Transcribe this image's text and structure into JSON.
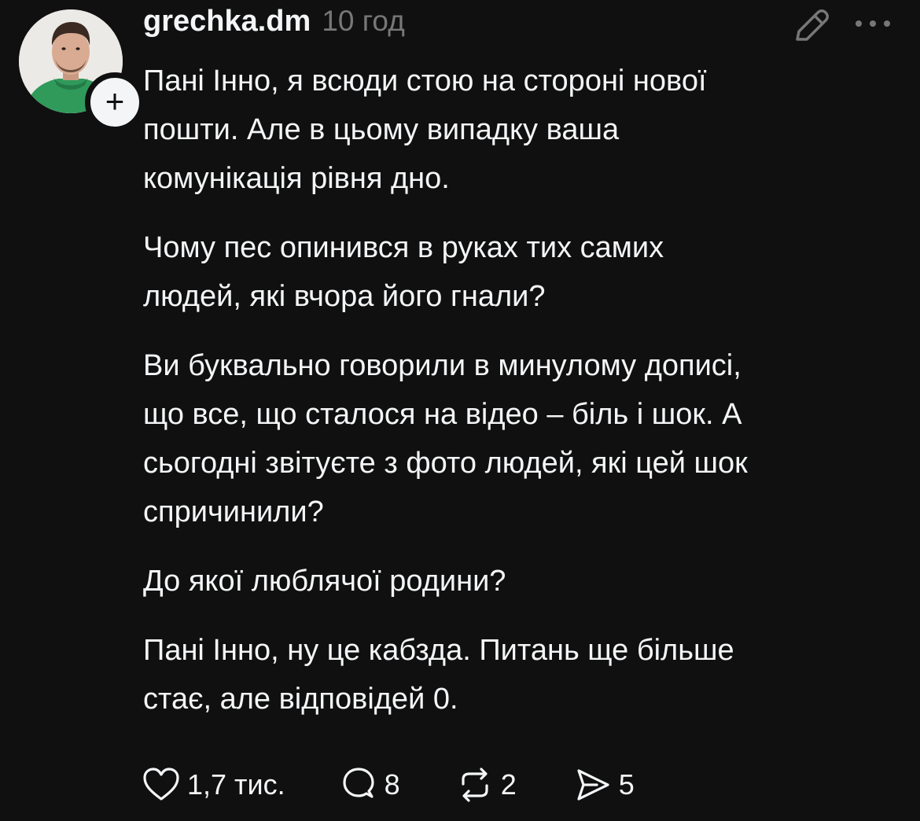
{
  "post": {
    "author": {
      "username": "grechka.dm",
      "avatar_icon": "profile-photo",
      "follow_badge": "+"
    },
    "timestamp": "10 год",
    "header_actions": {
      "edit_icon": "pencil-icon",
      "more_icon": "ellipsis-icon"
    },
    "paragraphs": [
      "Пані Інно, я всюди стою на стороні нової\nпошти. Але в цьому випадку ваша\nкомунікація рівня дно.",
      "Чому пес опинився в руках тих самих\nлюдей, які вчора його гнали?",
      "Ви буквально говорили в минулому дописі,\nщо все, що сталося на відео – біль і шок. А\nсьогодні звітуєте з фото людей, які цей шок\nспричинили?",
      "До якої люблячої родини?",
      "Пані Інно, ну це кабзда. Питань ще більше\nстає, але відповідей 0."
    ],
    "actions": {
      "likes": "1,7 тис.",
      "comments": "8",
      "reposts": "2",
      "shares": "5"
    }
  },
  "colors": {
    "background": "#101010",
    "text": "#f3f5f7",
    "muted": "#777777",
    "avatar_hoodie": "#2f9a5a"
  }
}
